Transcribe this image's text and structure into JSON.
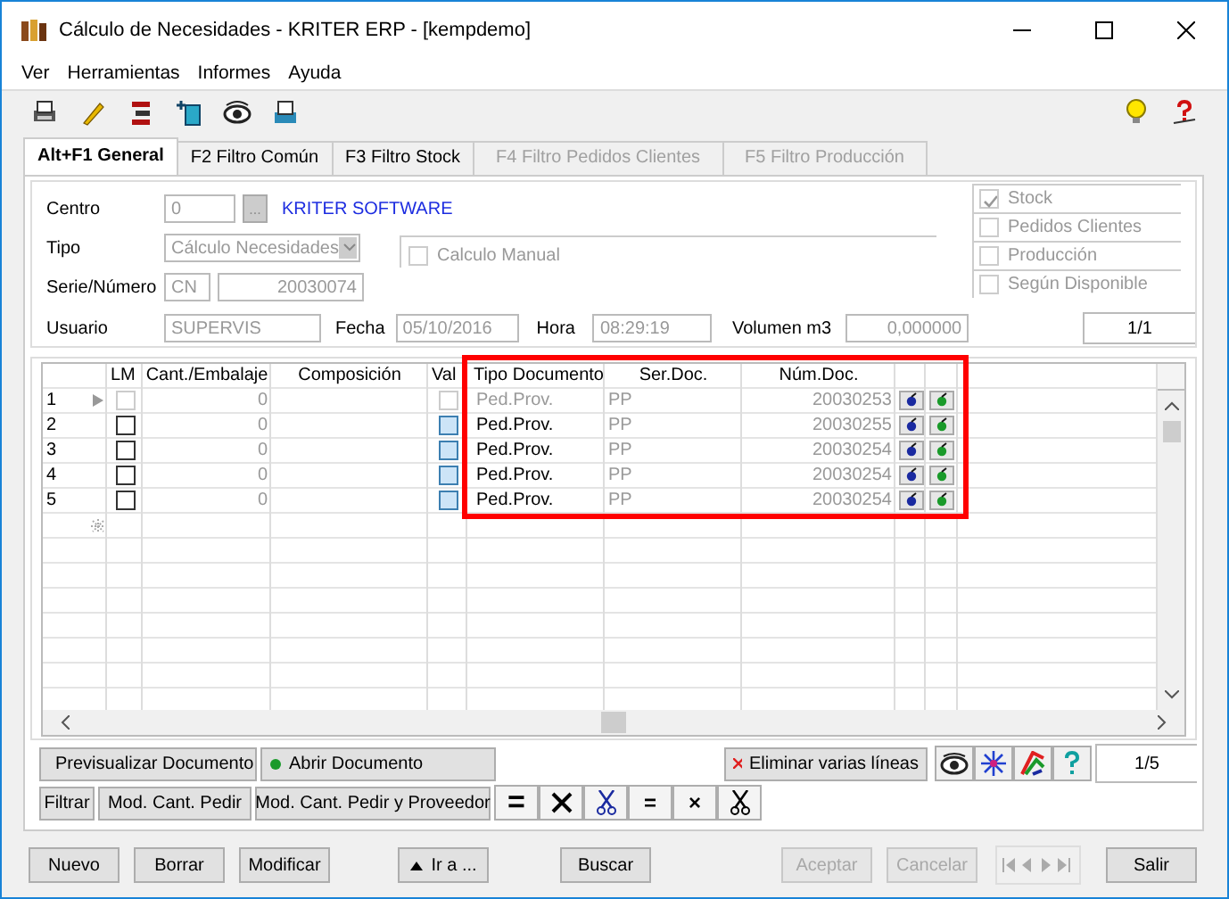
{
  "window": {
    "title": "Cálculo de Necesidades - KRITER ERP - [kempdemo]"
  },
  "menu": [
    "Ver",
    "Herramientas",
    "Informes",
    "Ayuda"
  ],
  "tabs": [
    {
      "label": "Alt+F1 General",
      "selected": true,
      "disabled": false
    },
    {
      "label": "F2 Filtro Común",
      "selected": false,
      "disabled": false
    },
    {
      "label": "F3 Filtro Stock",
      "selected": false,
      "disabled": false
    },
    {
      "label": "F4 Filtro Pedidos Clientes",
      "selected": false,
      "disabled": true
    },
    {
      "label": "F5 Filtro Producción",
      "selected": false,
      "disabled": true
    }
  ],
  "form": {
    "centro_label": "Centro",
    "centro": "0",
    "browse": "...",
    "centro_name": "KRITER SOFTWARE",
    "tipo_label": "Tipo",
    "tipo": "Cálculo Necesidades",
    "manual_label": "Calculo Manual",
    "manual_checked": false,
    "serie_label": "Serie/Número",
    "serie": "CN",
    "numero": "20030074",
    "usuario_label": "Usuario",
    "usuario": "SUPERVIS",
    "fecha_label": "Fecha",
    "fecha": "05/10/2016",
    "hora_label": "Hora",
    "hora": "08:29:19",
    "volumen_label": "Volumen m3",
    "volumen": "0,000000",
    "counter": "1/1"
  },
  "options": [
    {
      "label": "Stock",
      "checked": true
    },
    {
      "label": "Pedidos Clientes",
      "checked": false
    },
    {
      "label": "Producción",
      "checked": false
    },
    {
      "label": "Según Disponible",
      "checked": false
    }
  ],
  "table": {
    "columns": [
      "LM",
      "Cant./Embalaje",
      "Composición",
      "Val",
      "Tipo Documento",
      "Ser.Doc.",
      "Núm.Doc."
    ],
    "rows": [
      {
        "number": "1",
        "current": true,
        "lm": false,
        "cantidad": "0",
        "val": false,
        "tipo": "Ped.Prov.",
        "serie": "PP",
        "numero": "20030253"
      },
      {
        "number": "2",
        "current": false,
        "lm": false,
        "cantidad": "0",
        "val": false,
        "tipo": "Ped.Prov.",
        "serie": "PP",
        "numero": "20030255"
      },
      {
        "number": "3",
        "current": false,
        "lm": false,
        "cantidad": "0",
        "val": false,
        "tipo": "Ped.Prov.",
        "serie": "PP",
        "numero": "20030254"
      },
      {
        "number": "4",
        "current": false,
        "lm": false,
        "cantidad": "0",
        "val": false,
        "tipo": "Ped.Prov.",
        "serie": "PP",
        "numero": "20030254"
      },
      {
        "number": "5",
        "current": false,
        "lm": false,
        "cantidad": "0",
        "val": false,
        "tipo": "Ped.Prov.",
        "serie": "PP",
        "numero": "20030254"
      }
    ]
  },
  "actions1": {
    "preview": "Previsualizar Documento",
    "open": "Abrir Documento",
    "delete": "Eliminar varias líneas",
    "counter": "1/5"
  },
  "actions2": {
    "buttons": [
      "Filtrar",
      "Mod. Cant. Pedir",
      "Mod. Cant. Pedir y Proveedor"
    ],
    "symbols": [
      {
        "kind": "text",
        "text": "="
      },
      {
        "kind": "cross-icon"
      },
      {
        "kind": "scissors-icon"
      },
      {
        "kind": "text",
        "text": "="
      },
      {
        "kind": "text",
        "text": "×"
      },
      {
        "kind": "scissors-icon"
      }
    ]
  },
  "bottom": [
    {
      "label": "Nuevo",
      "disabled": false
    },
    {
      "label": "Borrar",
      "disabled": false
    },
    {
      "label": "Modificar",
      "disabled": false
    },
    {
      "label": "Ir a ...",
      "disabled": false
    },
    {
      "label": "Buscar",
      "disabled": false
    },
    {
      "label": "Aceptar",
      "disabled": true
    },
    {
      "label": "Cancelar",
      "disabled": true
    },
    {
      "label": "Salir",
      "disabled": false
    }
  ]
}
